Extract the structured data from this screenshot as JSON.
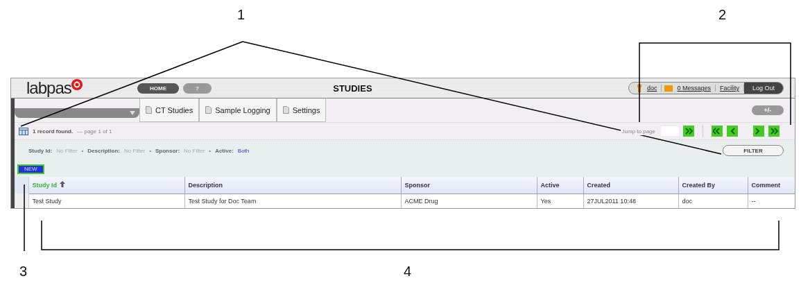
{
  "header": {
    "logo": "labpas",
    "home": "HOME",
    "help": "?",
    "title": "STUDIES",
    "user": "doc",
    "messages": "0 Messages",
    "facility": "Facility",
    "logout": "Log Out"
  },
  "tabs": [
    {
      "label": "CT Studies"
    },
    {
      "label": "Sample Logging"
    },
    {
      "label": "Settings"
    }
  ],
  "toggle_button": "+/-",
  "records": {
    "found": "1 record found.",
    "page": "— page 1 of 1",
    "jump_label": "Jump to page"
  },
  "filters": [
    {
      "label": "Study Id:",
      "value": "No Filter",
      "set": false
    },
    {
      "label": "Description:",
      "value": "No Filter",
      "set": false
    },
    {
      "label": "Sponsor:",
      "value": "No Filter",
      "set": false
    },
    {
      "label": "Active:",
      "value": "Both",
      "set": true
    }
  ],
  "filter_separator": "•",
  "filter_button": "FILTER",
  "new_button": "NEW",
  "table": {
    "columns": [
      {
        "label": "Study Id",
        "sorted": true
      },
      {
        "label": "Description",
        "sorted": false
      },
      {
        "label": "Sponsor",
        "sorted": false
      },
      {
        "label": "Active",
        "sorted": false
      },
      {
        "label": "Created",
        "sorted": false
      },
      {
        "label": "Created By",
        "sorted": false
      },
      {
        "label": "Comment",
        "sorted": false
      }
    ],
    "rows": [
      [
        "Test Study",
        "Test Study for Doc Team",
        "ACME Drug",
        "Yes",
        "27JUL2011 10:48",
        "doc",
        "--"
      ]
    ]
  },
  "callouts": [
    {
      "label": "1"
    },
    {
      "label": "2"
    },
    {
      "label": "3"
    },
    {
      "label": "4"
    }
  ]
}
